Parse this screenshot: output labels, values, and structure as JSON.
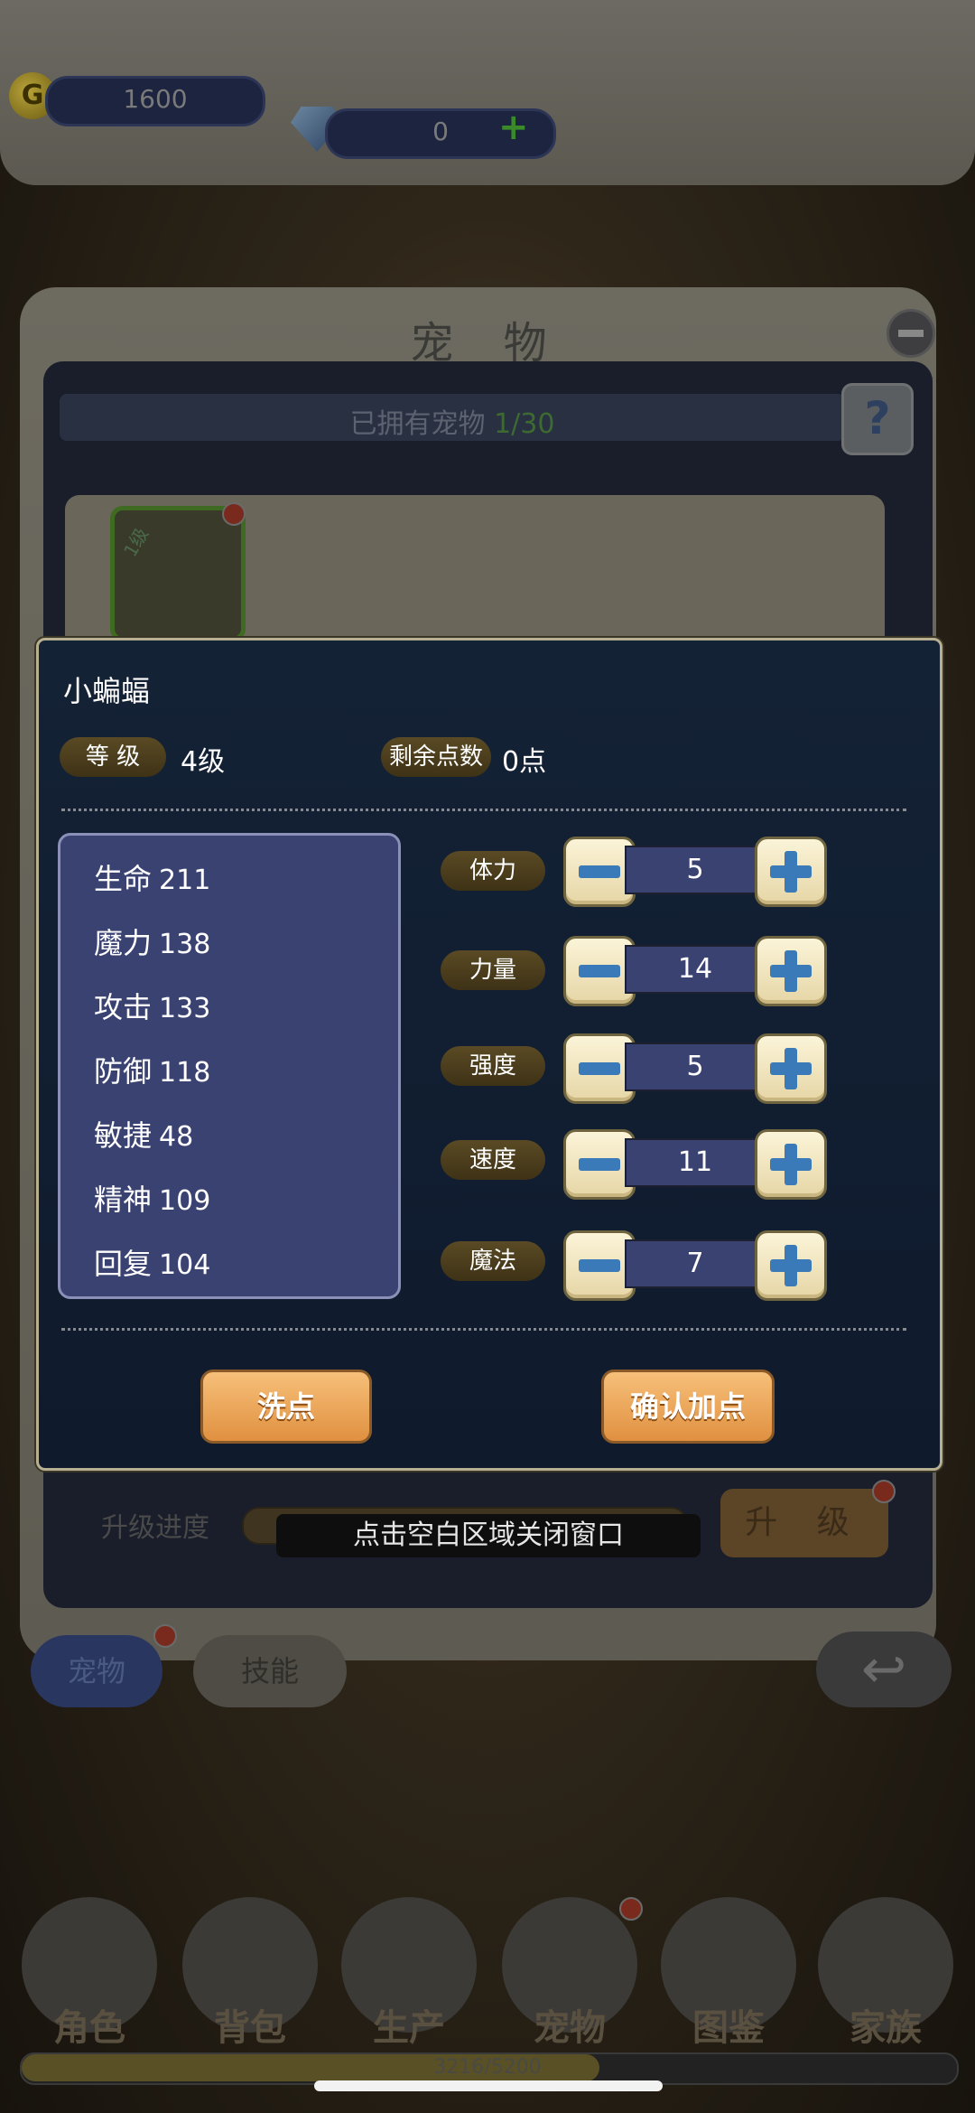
{
  "currency": {
    "gold": "1600",
    "gems": "0",
    "add_label": "+"
  },
  "pet_panel": {
    "title": "宠 物",
    "owned_label": "已拥有宠物",
    "owned_count": "1/30",
    "help_label": "?",
    "pet_level_badge": "1级",
    "upgrade_label": "升级进度",
    "upgrade_button": "升 级",
    "tabs": [
      "宠物",
      "技能"
    ],
    "back_glyph": "↩"
  },
  "toast": "点击空白区域关闭窗口",
  "dialog": {
    "pet_name": "小蝙蝠",
    "level_label": "等 级",
    "level_value": "4级",
    "points_label": "剩余点数",
    "points_value": "0点",
    "stats": [
      {
        "name": "生命",
        "value": "211"
      },
      {
        "name": "魔力",
        "value": "138"
      },
      {
        "name": "攻击",
        "value": "133"
      },
      {
        "name": "防御",
        "value": "118"
      },
      {
        "name": "敏捷",
        "value": "48"
      },
      {
        "name": "精神",
        "value": "109"
      },
      {
        "name": "回复",
        "value": "104"
      }
    ],
    "attributes": [
      {
        "name": "体力",
        "value": "5"
      },
      {
        "name": "力量",
        "value": "14"
      },
      {
        "name": "强度",
        "value": "5"
      },
      {
        "name": "速度",
        "value": "11"
      },
      {
        "name": "魔法",
        "value": "7"
      }
    ],
    "reset_button": "洗点",
    "confirm_button": "确认加点"
  },
  "bottom_nav": [
    "角色",
    "背包",
    "生产",
    "宠物",
    "图鉴",
    "家族"
  ],
  "exp": {
    "text": "3216/5200",
    "fraction": 0.62
  },
  "colors": {
    "accent_orange": "#e09040",
    "stat_panel": "#3a4272",
    "dialog_bg": "#142236"
  }
}
